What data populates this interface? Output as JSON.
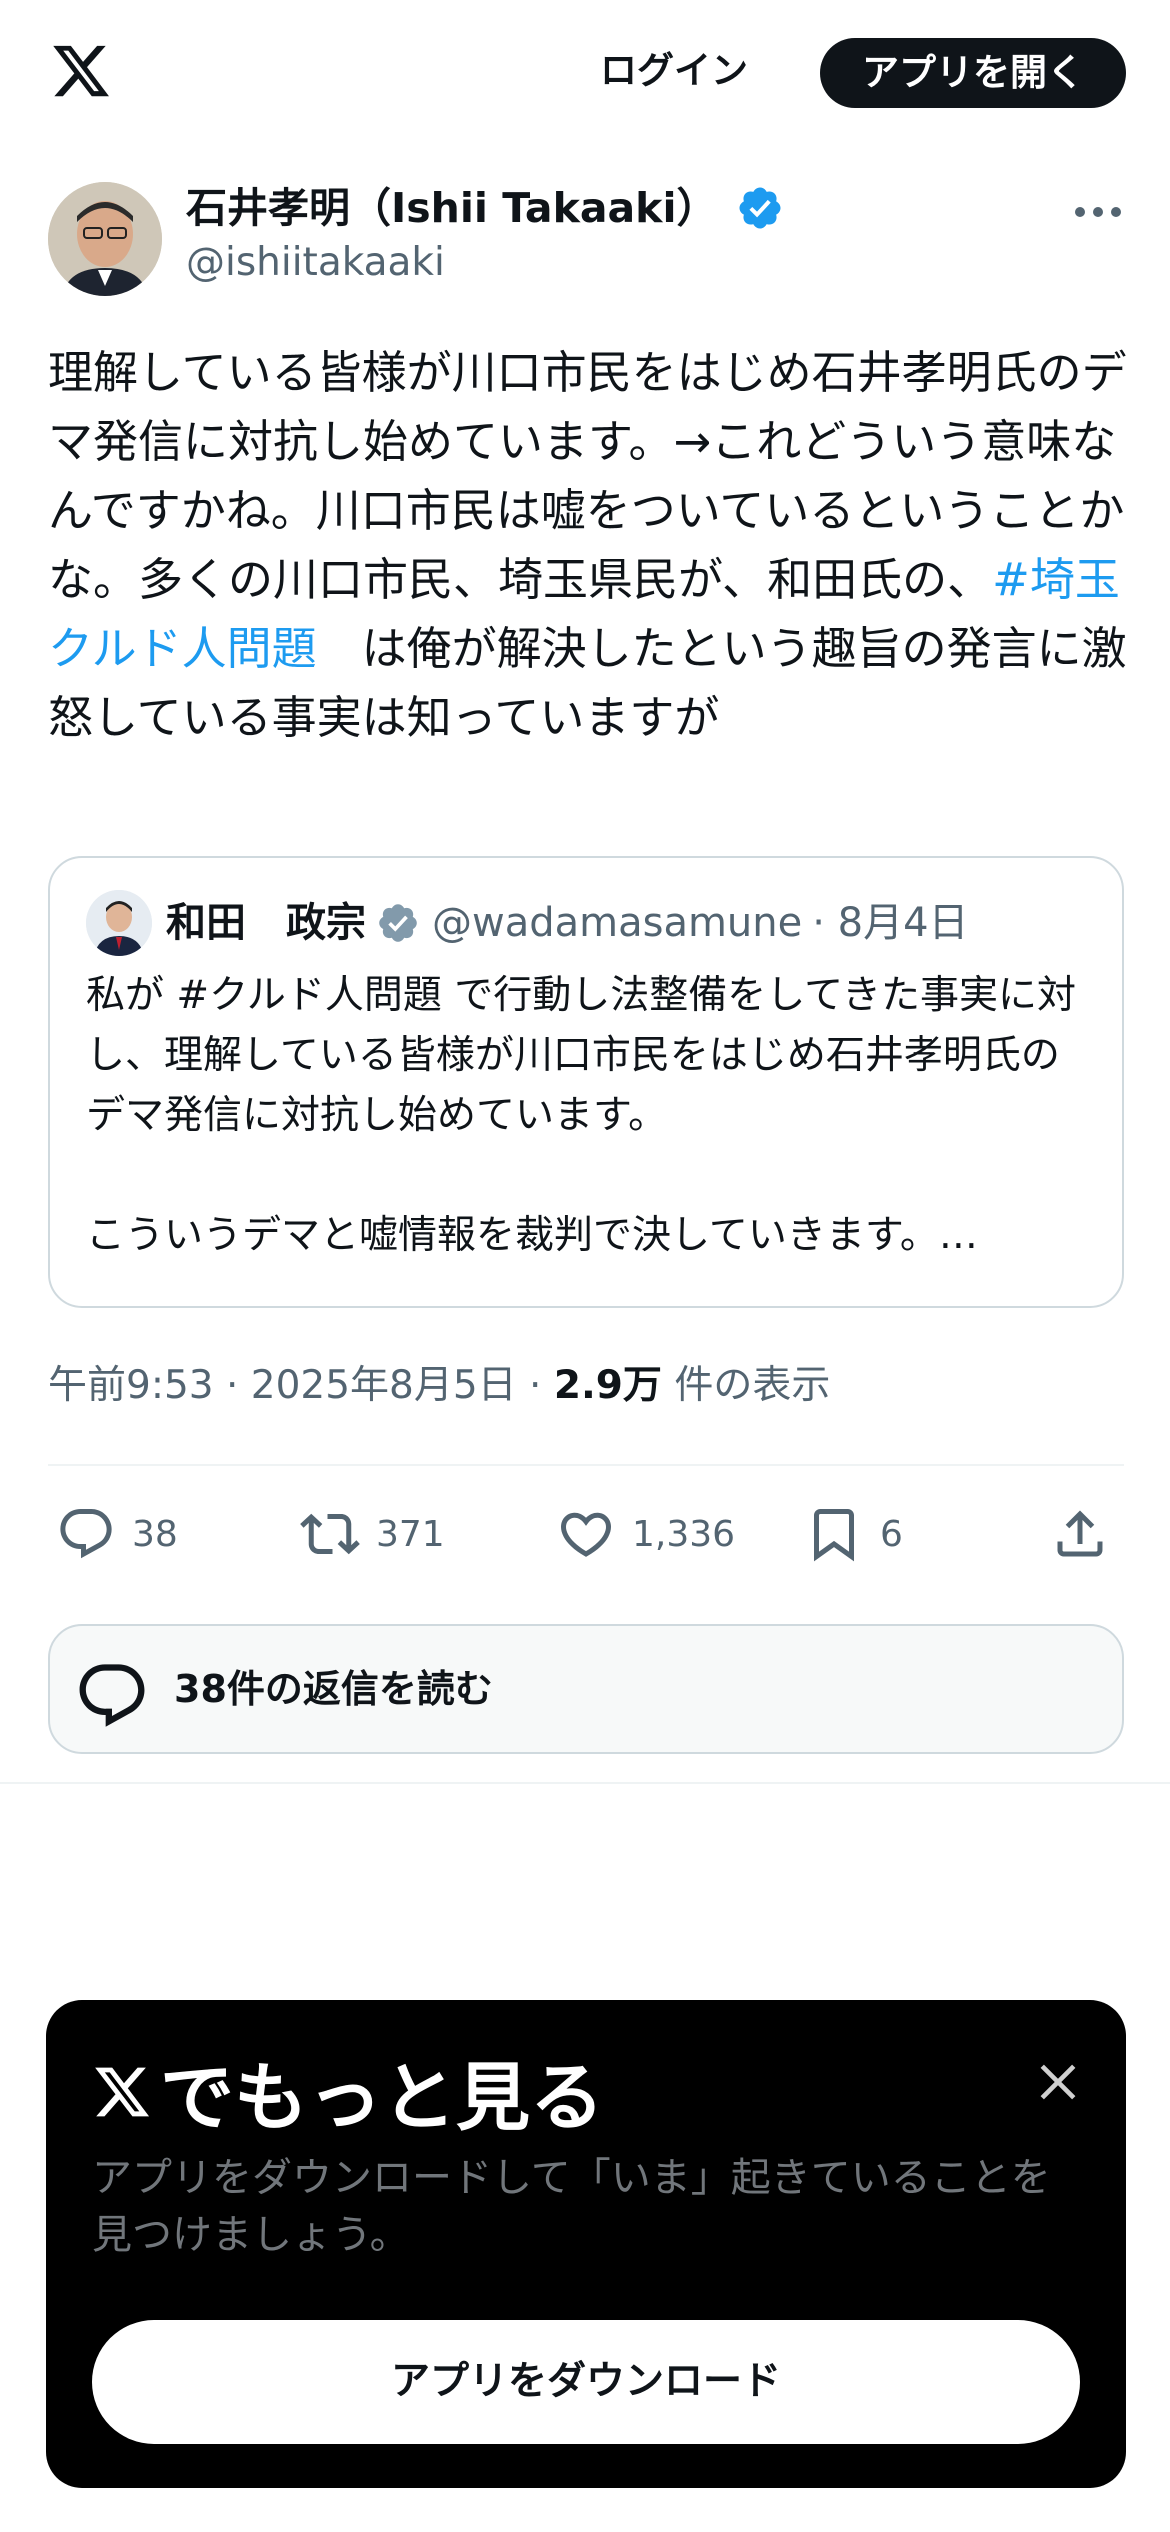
{
  "header": {
    "logo_icon": "x-logo-icon",
    "login_label": "ログイン",
    "open_app_label": "アプリを開く"
  },
  "tweet": {
    "author_name": "石井孝明（Ishii Takaaki）",
    "author_handle": "@ishiitakaaki",
    "text_before_hashtag": "理解している皆様が川口市民をはじめ石井孝明氏のデマ発信に対抗し始めています。→これどういう意味なんですかね。川口市民は嘘をついているということかな。多くの川口市民、埼玉県民が、和田氏の、",
    "hashtag": "#埼玉クルド人問題",
    "text_after_hashtag": "　は俺が解決したという趣旨の発言に激怒している事実は知っていますが",
    "quote": {
      "name": "和田　政宗",
      "handle": "@wadamasamune",
      "date": "· 8月4日",
      "line1": "私が #クルド人問題 で行動し法整備をしてきた事実に対し、理解している皆様が川口市民をはじめ石井孝明氏のデマ発信に対抗し始めています。",
      "line2": "こういうデマと嘘情報を裁判で決していきます。…"
    },
    "meta": {
      "time_date": "午前9:53 · 2025年8月5日 · ",
      "views": "2.9万",
      "views_label": " 件の表示"
    },
    "actions": {
      "replies": "38",
      "retweets": "371",
      "likes": "1,336",
      "bookmarks": "6"
    },
    "read_replies_label": "38件の返信を読む"
  },
  "promo": {
    "title": "でもっと見る",
    "subtitle": "アプリをダウンロードして「いま」起きていることを見つけましょう。",
    "button_label": "アプリをダウンロード"
  },
  "colors": {
    "accent": "#1d9bf0",
    "text": "#0f1419",
    "muted": "#536471",
    "verified_gray": "#829aab"
  }
}
